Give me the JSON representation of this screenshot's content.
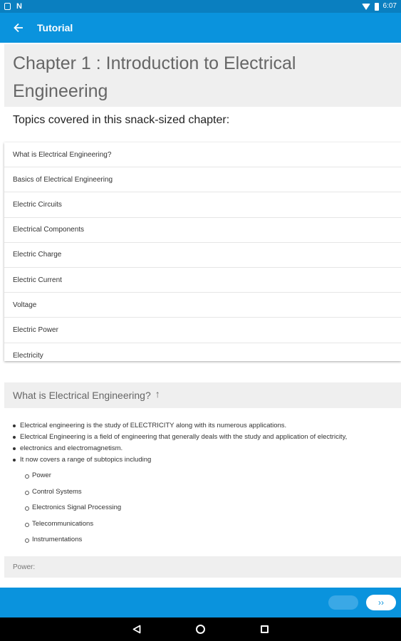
{
  "status_bar": {
    "time": "6:07"
  },
  "app_bar": {
    "title": "Tutorial"
  },
  "chapter": {
    "title": "Chapter 1 : Introduction to Electrical Engineering",
    "topics_heading": "Topics covered in this snack-sized chapter:"
  },
  "topics": [
    "What is Electrical Engineering?",
    "Basics of Electrical Engineering",
    "Electric Circuits",
    "Electrical Components",
    "Electric Charge",
    "Electric Current",
    "Voltage",
    "Electric Power",
    "Electricity"
  ],
  "section": {
    "title": "What is Electrical Engineering?",
    "bullets": [
      "Electrical engineering is the study of ELECTRICITY along with its numerous applications.",
      "Electrical Engineering is a field of engineering that generally deals with the study and application of electricity,",
      "electronics and electromagnetism.",
      "It now covers a range of subtopics including"
    ],
    "subtopics": [
      "Power",
      "Control Systems",
      "Electronics Signal Processing",
      "Telecommunications",
      "Instrumentations"
    ]
  },
  "next_section": {
    "title": "Power:"
  },
  "bottom_bar": {
    "next_label": "››"
  },
  "colors": {
    "status_bar": "#0a7fc0",
    "app_bar": "#0a93dd",
    "header_bg": "#efefef"
  }
}
